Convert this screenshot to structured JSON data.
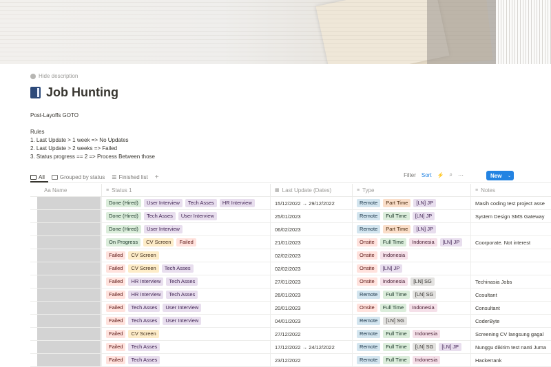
{
  "page": {
    "hide_description": "Hide description",
    "title": "Job Hunting",
    "description": [
      "Post-Layoffs GOTO",
      "",
      "Rules",
      "1. Last Update > 1 week => No Updates",
      "2. Last Update > 2 weeks => Failed",
      "3. Status progress == 2 => Process Between those"
    ]
  },
  "views": {
    "tabs": [
      {
        "label": "All",
        "icon": "table-icon"
      },
      {
        "label": "Grouped by status",
        "icon": "board-icon"
      },
      {
        "label": "Finished list",
        "icon": "list-icon"
      }
    ],
    "add": "+",
    "filter": "Filter",
    "sort": "Sort",
    "automation_icon": "lightning-icon",
    "search_icon": "search-icon",
    "more": "···",
    "new_label": "New",
    "new_caret": "⌄"
  },
  "columns": [
    {
      "label": "Aa Name",
      "icon": ""
    },
    {
      "label": "Status 1",
      "icon": "≡"
    },
    {
      "label": "Last Update (Dates)",
      "icon": "▦"
    },
    {
      "label": "Type",
      "icon": "≡"
    },
    {
      "label": "Notes",
      "icon": "≡"
    }
  ],
  "tag_colors": {
    "Done (Hired)": "c-green",
    "On Progress": "c-green",
    "Failed": "c-red",
    "User Interview": "c-purple",
    "Tech Asses": "c-purple",
    "HR Interview": "c-purple",
    "CV Screen": "c-yellow",
    "Remote": "c-blue",
    "Onsite": "c-red",
    "Part Time": "c-orange",
    "Full Time": "c-green",
    "[LN] JP": "c-purple",
    "[LN] SG": "c-gray",
    "Indonesia": "c-pink"
  },
  "rows": [
    {
      "status": [
        "Done (Hired)",
        "User Interview",
        "Tech Asses",
        "HR Interview"
      ],
      "update": "15/12/2022 → 29/12/2022",
      "type": [
        "Remote",
        "Part Time",
        "[LN] JP"
      ],
      "notes": "Masih coding test project asse"
    },
    {
      "status": [
        "Done (Hired)",
        "Tech Asses",
        "User Interview"
      ],
      "update": "25/01/2023",
      "type": [
        "Remote",
        "Full Time",
        "[LN] JP"
      ],
      "notes": "System Design SMS Gateway"
    },
    {
      "status": [
        "Done (Hired)",
        "User Interview"
      ],
      "update": "06/02/2023",
      "type": [
        "Remote",
        "Part Time",
        "[LN] JP"
      ],
      "notes": ""
    },
    {
      "status": [
        "On Progress",
        "CV Screen",
        "Failed"
      ],
      "update": "21/01/2023",
      "type": [
        "Onsite",
        "Full Time",
        "Indonesia",
        "[LN] JP"
      ],
      "notes": "Coorporate. Not interest"
    },
    {
      "status": [
        "Failed",
        "CV Screen"
      ],
      "update": "02/02/2023",
      "type": [
        "Onsite",
        "Indonesia"
      ],
      "notes": ""
    },
    {
      "status": [
        "Failed",
        "CV Screen",
        "Tech Asses"
      ],
      "update": "02/02/2023",
      "type": [
        "Onsite",
        "[LN] JP"
      ],
      "notes": ""
    },
    {
      "status": [
        "Failed",
        "HR Interview",
        "Tech Asses"
      ],
      "update": "27/01/2023",
      "type": [
        "Onsite",
        "Indonesia",
        "[LN] SG"
      ],
      "notes": "Techinasia Jobs"
    },
    {
      "status": [
        "Failed",
        "HR Interview",
        "Tech Asses"
      ],
      "update": "26/01/2023",
      "type": [
        "Remote",
        "Full Time",
        "[LN] SG"
      ],
      "notes": "Cosultant"
    },
    {
      "status": [
        "Failed",
        "Tech Asses",
        "User Interview"
      ],
      "update": "20/01/2023",
      "type": [
        "Onsite",
        "Full Time",
        "Indonesia"
      ],
      "notes": "Consultant"
    },
    {
      "status": [
        "Failed",
        "Tech Asses",
        "User Interview"
      ],
      "update": "04/01/2023",
      "type": [
        "Remote",
        "[LN] SG"
      ],
      "notes": "CoderByte"
    },
    {
      "status": [
        "Failed",
        "CV Screen"
      ],
      "update": "27/12/2022",
      "type": [
        "Remote",
        "Full Time",
        "Indonesia"
      ],
      "notes": "Screening CV langsung gagal"
    },
    {
      "status": [
        "Failed",
        "Tech Asses"
      ],
      "update": "17/12/2022 → 24/12/2022",
      "type": [
        "Remote",
        "Full Time",
        "[LN] SG",
        "[LN] JP"
      ],
      "notes": "Nunggu dikirim test nanti Juma"
    },
    {
      "status": [
        "Failed",
        "Tech Asses"
      ],
      "update": "23/12/2022",
      "type": [
        "Remote",
        "Full Time",
        "Indonesia"
      ],
      "notes": "Hackerrank"
    }
  ]
}
